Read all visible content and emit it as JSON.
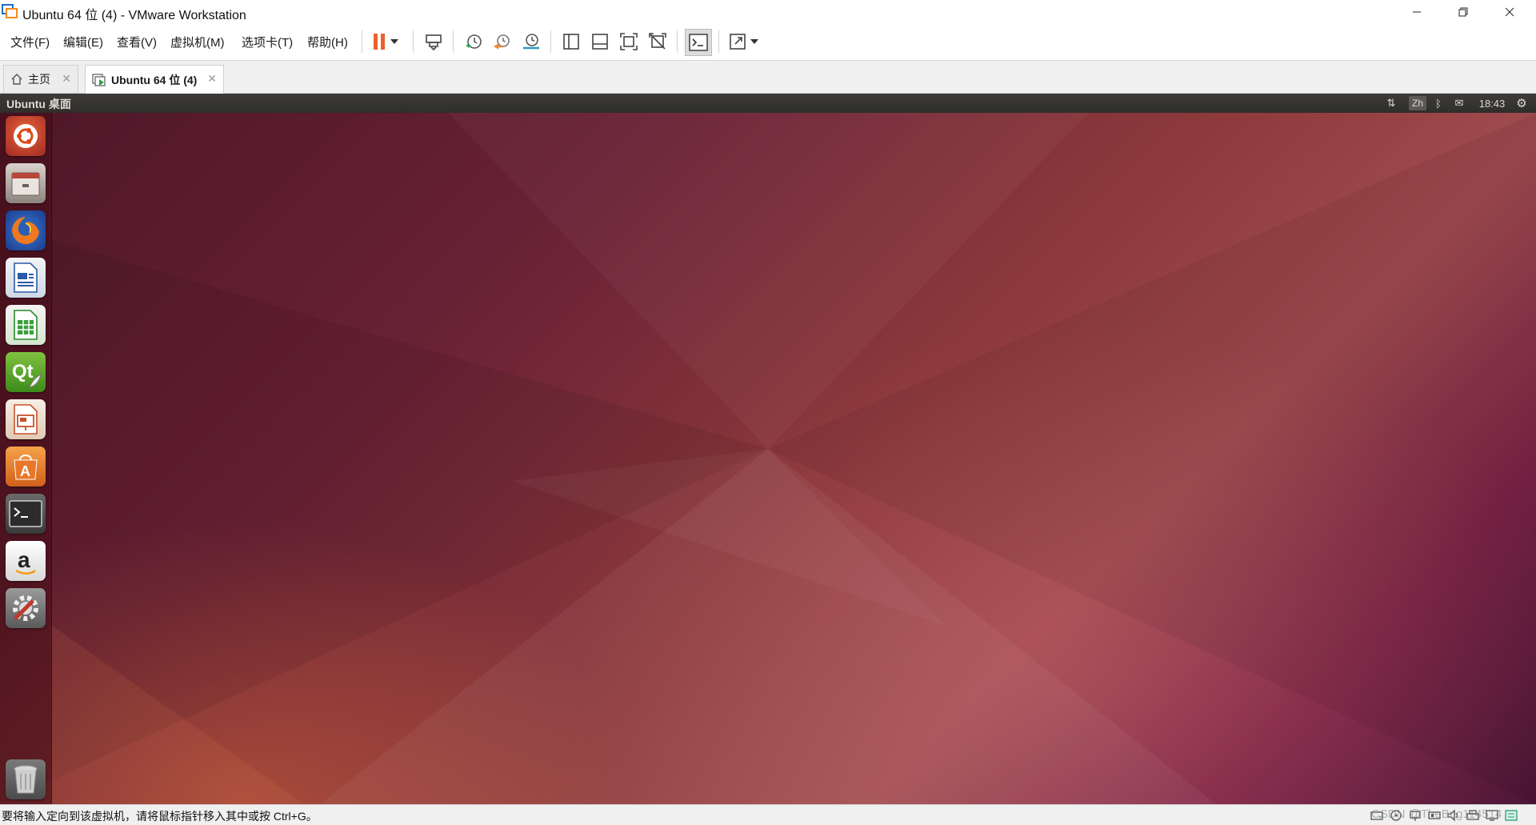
{
  "window": {
    "title": "Ubuntu 64 位 (4) - VMware Workstation",
    "controls": {
      "minimize": "—",
      "maximize": "❐",
      "close": "✕"
    }
  },
  "menu": {
    "items": [
      "文件(F)",
      "编辑(E)",
      "查看(V)",
      "虚拟机(M)",
      "选项卡(T)",
      "帮助(H)"
    ]
  },
  "toolbar": {
    "icons": [
      "pause-icon",
      "dropdown-icon",
      "send-ctrl-alt-del-icon",
      "snapshot-icon",
      "revert-snapshot-icon",
      "snapshot-manager-icon",
      "show-library-icon",
      "thumbnail-bar-icon",
      "fit-guest-icon",
      "unity-icon",
      "console-view-icon",
      "fullscreen-icon",
      "dropdown-icon"
    ],
    "accent_pause": "#e8622c"
  },
  "tabs": [
    {
      "label": "主页",
      "active": false,
      "close": "✕"
    },
    {
      "label": "Ubuntu 64 位 (4)",
      "active": true,
      "close": "✕"
    }
  ],
  "ubuntu": {
    "panel_title": "Ubuntu 桌面",
    "indicators": {
      "network": "⇅",
      "keyboard": "Zh",
      "bluetooth": "ᛒ",
      "mail": "✉",
      "clock": "18:43",
      "settings": "⚙"
    },
    "launcher": [
      "dash-icon",
      "files-icon",
      "firefox-icon",
      "writer-icon",
      "calc-icon",
      "qt-creator-icon",
      "impress-icon",
      "software-center-icon",
      "terminal-icon",
      "amazon-icon",
      "system-settings-icon",
      "trash-icon"
    ]
  },
  "status": {
    "message": "要将输入定向到该虚拟机，请将鼠标指针移入其中或按 Ctrl+G。",
    "watermark": "CSDN @TheBug114514"
  }
}
